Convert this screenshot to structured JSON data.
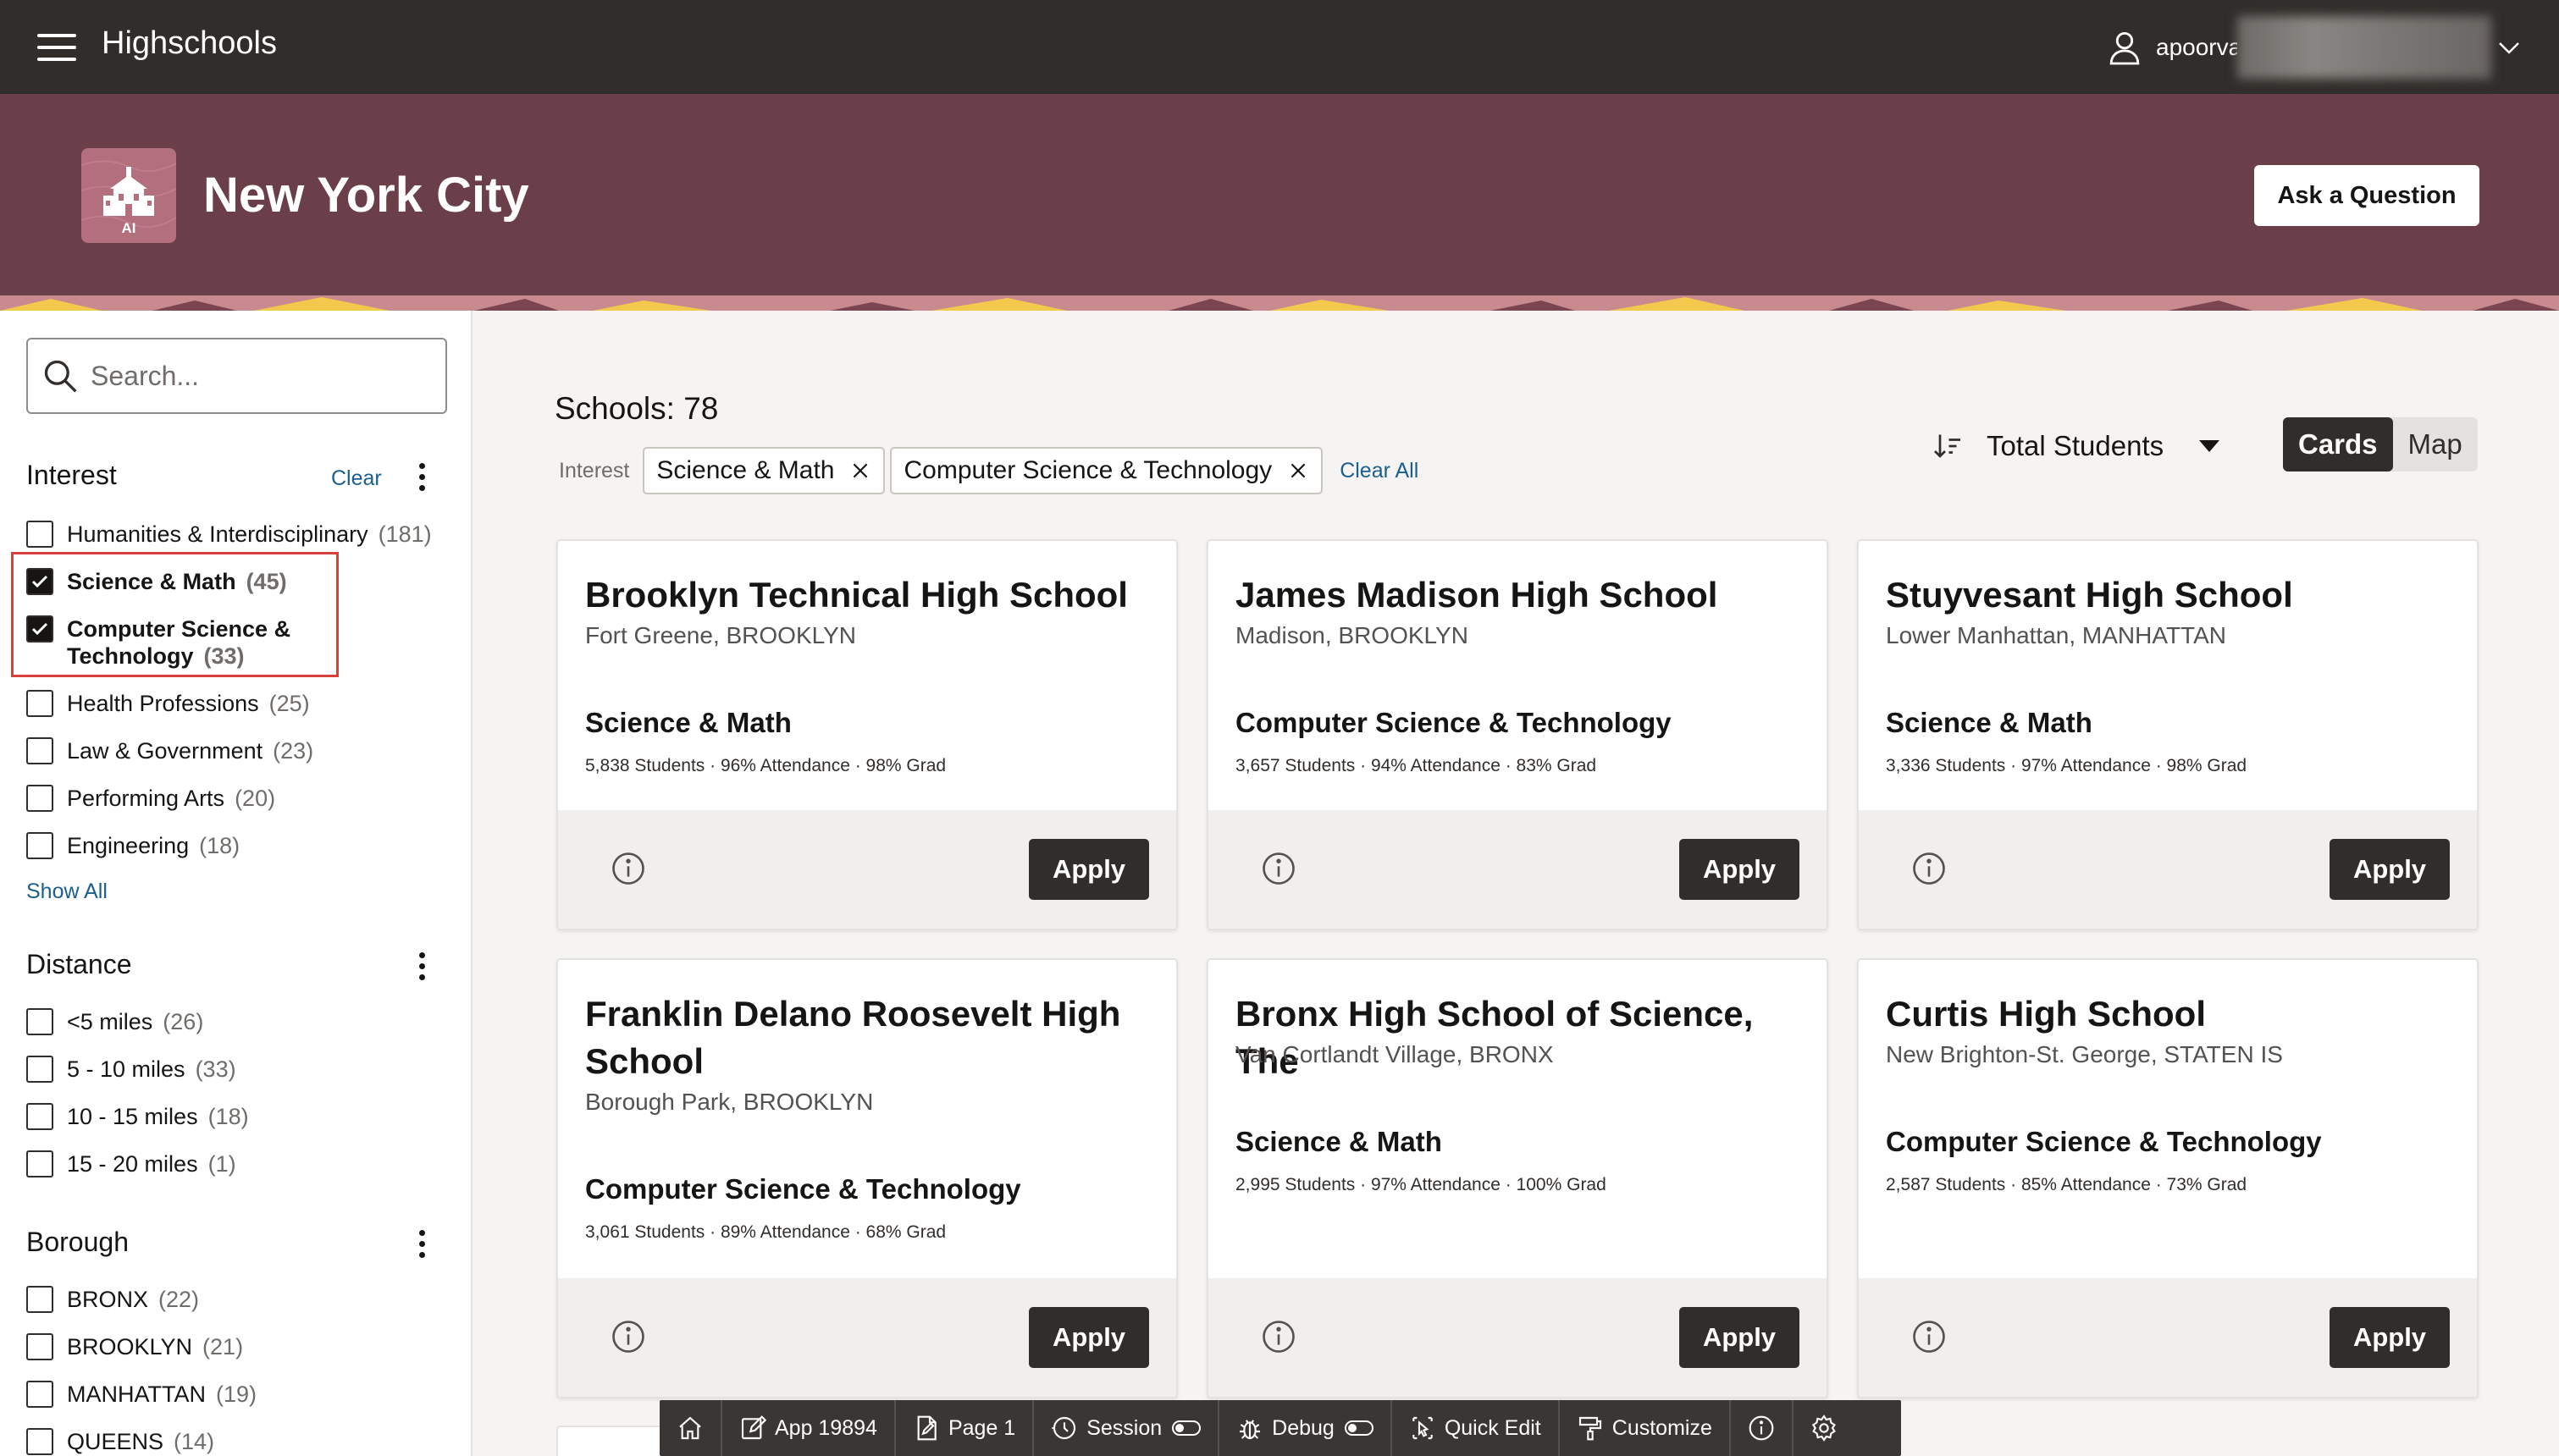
{
  "header": {
    "app_title": "Highschools",
    "user_name": "apoorva"
  },
  "hero": {
    "title": "New York City",
    "logo_text": "AI",
    "ask_button": "Ask a Question"
  },
  "search": {
    "placeholder": "Search..."
  },
  "facets": {
    "interest": {
      "title": "Interest",
      "clear_label": "Clear",
      "options": [
        {
          "label": "Humanities & Interdisciplinary",
          "count": "(181)",
          "checked": false
        },
        {
          "label": "Science & Math",
          "count": "(45)",
          "checked": true
        },
        {
          "label": "Computer Science &",
          "label2": "Technology",
          "count": "(33)",
          "checked": true
        },
        {
          "label": "Health Professions",
          "count": "(25)",
          "checked": false
        },
        {
          "label": "Law & Government",
          "count": "(23)",
          "checked": false
        },
        {
          "label": "Performing Arts",
          "count": "(20)",
          "checked": false
        },
        {
          "label": "Engineering",
          "count": "(18)",
          "checked": false
        }
      ],
      "show_all": "Show All"
    },
    "distance": {
      "title": "Distance",
      "options": [
        {
          "label": "<5 miles",
          "count": "(26)"
        },
        {
          "label": "5 - 10 miles",
          "count": "(33)"
        },
        {
          "label": "10 - 15 miles",
          "count": "(18)"
        },
        {
          "label": "15 - 20 miles",
          "count": "(1)"
        }
      ]
    },
    "borough": {
      "title": "Borough",
      "options": [
        {
          "label": "BRONX",
          "count": "(22)"
        },
        {
          "label": "BROOKLYN",
          "count": "(21)"
        },
        {
          "label": "MANHATTAN",
          "count": "(19)"
        },
        {
          "label": "QUEENS",
          "count": "(14)"
        }
      ]
    }
  },
  "results": {
    "count_label": "Schools: 78",
    "filter_label": "Interest",
    "chips": [
      "Science & Math",
      "Computer Science & Technology"
    ],
    "clear_all": "Clear All",
    "sort_label": "Total Students",
    "view_cards": "Cards",
    "view_map": "Map"
  },
  "cards": [
    {
      "name": "Brooklyn Technical High School",
      "location": "Fort Greene, BROOKLYN",
      "interest": "Science & Math",
      "stats": "5,838 Students · 96% Attendance · 98% Grad",
      "apply": "Apply"
    },
    {
      "name": "James Madison High School",
      "location": "Madison, BROOKLYN",
      "interest": "Computer Science & Technology",
      "stats": "3,657 Students · 94% Attendance · 83% Grad",
      "apply": "Apply"
    },
    {
      "name": "Stuyvesant High School",
      "location": "Lower Manhattan, MANHATTAN",
      "interest": "Science & Math",
      "stats": "3,336 Students · 97% Attendance · 98% Grad",
      "apply": "Apply"
    },
    {
      "name": "Franklin Delano Roosevelt High School",
      "location": "Borough Park, BROOKLYN",
      "interest": "Computer Science & Technology",
      "stats": "3,061 Students · 89% Attendance · 68% Grad",
      "apply": "Apply"
    },
    {
      "name": "Bronx High School of Science, The",
      "location": "Van Cortlandt Village, BRONX",
      "interest": "Science & Math",
      "stats": "2,995 Students · 97% Attendance · 100% Grad",
      "apply": "Apply"
    },
    {
      "name": "Curtis High School",
      "location": "New Brighton-St. George, STATEN IS",
      "interest": "Computer Science & Technology",
      "stats": "2,587 Students · 85% Attendance · 73% Grad",
      "apply": "Apply"
    }
  ],
  "devbar": {
    "app": "App 19894",
    "page": "Page 1",
    "session": "Session",
    "debug": "Debug",
    "quick_edit": "Quick Edit",
    "customize": "Customize"
  },
  "colors": {
    "topbar": "#312d2a",
    "hero": "#6b3f4a",
    "link": "#1a5f8e",
    "highlight": "#d6423a"
  }
}
